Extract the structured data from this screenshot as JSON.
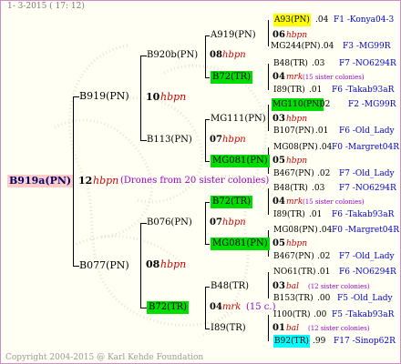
{
  "header": "1- 3-2015 ( 17: 12)",
  "footer": "Copyright 2004-2015 @ Karl Kehde Foundation",
  "colors": {
    "yellow": "#ffff00",
    "green": "#00dd00",
    "cyan": "#00ffff",
    "pink": "#ffcccc",
    "hbpn_red": "#cc0000",
    "purple": "#9900cc",
    "blue": "#0000cc"
  },
  "root": {
    "name": "B919a(PN)",
    "num": "12",
    "tag": "hbpn",
    "note": "(Drones from 20 sister colonies)"
  },
  "level1": [
    {
      "name": "B919(PN)",
      "num": "10",
      "tag": "hbpn"
    },
    {
      "name": "B077(PN)",
      "num": "08",
      "tag": "hbpn"
    }
  ],
  "level2": [
    {
      "name": "B920b(PN)",
      "num": "08",
      "tag": "hbpn"
    },
    {
      "name": "B113(PN)",
      "num": "07",
      "tag": "hbpn"
    },
    {
      "name": "B076(PN)",
      "num": "07",
      "tag": "hbpn"
    },
    {
      "name": "B72(TR)",
      "num": "04",
      "tag": "mrk",
      "note": "(15 c.)"
    }
  ],
  "level3": [
    {
      "name": "A919(PN)",
      "num": "06",
      "tag": "hbpn"
    },
    {
      "name": "B72(TR)",
      "num": "04",
      "tag": "mrk",
      "note": "(15 sister colonies)"
    },
    {
      "name": "MG111(PN)",
      "num": "03",
      "tag": "hbpn"
    },
    {
      "name": "MG081(PN)",
      "num": "05",
      "tag": "hbpn"
    },
    {
      "name": "B72(TR)",
      "num": "04",
      "tag": "mrk",
      "note": "(15 sister colonies)"
    },
    {
      "name": "MG081(PN)",
      "num": "05",
      "tag": "hbpn"
    },
    {
      "name": "B48(TR)",
      "num": "03",
      "tag": "bal",
      "note": "(12 sister colonies)"
    },
    {
      "name": "I89(TR)",
      "num": "01",
      "tag": "bal",
      "note": "(12 sister colonies)"
    }
  ],
  "level4": [
    {
      "name": "A93(PN)",
      "val": ".04",
      "code": "F1 -Konya04-3"
    },
    {
      "name": "MG244(PN)",
      "val": ".04",
      "code": "F3 -MG99R"
    },
    {
      "name": "B48(TR)",
      "val": ".03",
      "code": "F7 -NO6294R"
    },
    {
      "name": "I89(TR)",
      "val": ".01",
      "code": "F6 -Takab93aR"
    },
    {
      "name": "MG110(PN)",
      "val": ".02",
      "code": "F2 -MG99R"
    },
    {
      "name": "B107(PN)",
      "val": ".01",
      "code": "F6 -Old_Lady"
    },
    {
      "name": "MG08(PN)",
      "val": ".04",
      "code": "F0 -Margret04R"
    },
    {
      "name": "B467(PN)",
      "val": ".02",
      "code": "F7 -Old_Lady"
    },
    {
      "name": "B48(TR)",
      "val": ".03",
      "code": "F7 -NO6294R"
    },
    {
      "name": "I89(TR)",
      "val": ".01",
      "code": "F6 -Takab93aR"
    },
    {
      "name": "MG08(PN)",
      "val": ".04",
      "code": "F0 -Margret04R"
    },
    {
      "name": "B467(PN)",
      "val": ".02",
      "code": "F7 -Old_Lady"
    },
    {
      "name": "NO61(TR)",
      "val": ".01",
      "code": "F6 -NO6294R"
    },
    {
      "name": "B153(TR)",
      "val": ".00",
      "code": "F5 -Old_Lady"
    },
    {
      "name": "I100(TR)",
      "val": ".00",
      "code": "F5 -Takab93aR"
    },
    {
      "name": "B92(TR)",
      "val": ".99",
      "code": "F17 -Sinop62R"
    }
  ]
}
